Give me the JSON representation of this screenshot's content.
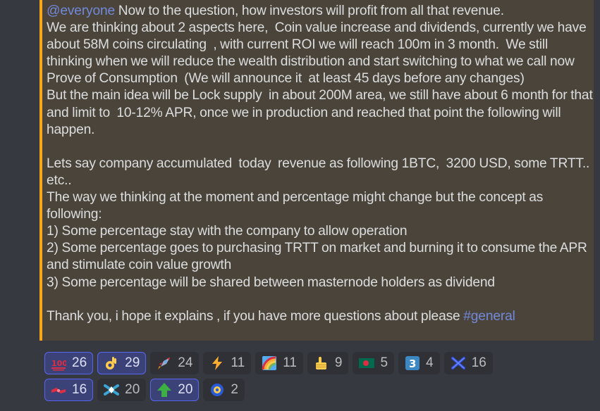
{
  "message": {
    "mention": "@everyone",
    "line1_rest": " Now to the question, how investors will profit from all that revenue.",
    "paragraph_main": "We are thinking about 2 aspects here,  Coin value increase and dividends, currently we have about 58M coins circulating  , with current ROI we will reach 100m in 3 month.  We still thinking when we will reduce the wealth distribution and start switching to what we call now Prove of Consumption  (We will announce it  at least 45 days before any changes)\nBut the main idea will be Lock supply  in about 200M area, we still have about 6 month for that and limit to  10-12% APR, once we in production and reached that point the following will happen.\n\nLets say company accumulated  today  revenue as following 1BTC,  3200 USD, some TRTT.. etc..\nThe way we thinking at the moment and percentage might change but the concept as following:\n1) Some percentage stay with the company to allow operation\n2) Some percentage goes to purchasing TRTT on market and burning it to consume the APR and stimulate coin value growth\n3) Some percentage will be shared between masternode holders as dividend\n\nThank you, i hope it explains , if you have more questions about please ",
    "channel": "#general"
  },
  "reactions": {
    "row1": [
      {
        "icon": "hundred-icon",
        "count": "26",
        "me": true
      },
      {
        "icon": "ok-hand-icon",
        "count": "29",
        "me": true
      },
      {
        "icon": "rocket-icon",
        "count": "24",
        "me": false
      },
      {
        "icon": "lightning-icon",
        "count": "11",
        "me": false
      },
      {
        "icon": "rainbow-icon",
        "count": "11",
        "me": false
      },
      {
        "icon": "thumbs-up-icon",
        "count": "9",
        "me": false
      },
      {
        "icon": "bangladesh-flag-icon",
        "count": "5",
        "me": false
      },
      {
        "icon": "keycap-three-icon",
        "count": "4",
        "me": false
      },
      {
        "icon": "cross-mark-icon",
        "count": "16",
        "me": false
      }
    ],
    "row2": [
      {
        "icon": "handshake-icon",
        "count": "16",
        "me": true
      },
      {
        "icon": "tortuga-logo-icon",
        "count": "20",
        "me": false
      },
      {
        "icon": "up-arrow-icon",
        "count": "20",
        "me": true
      },
      {
        "icon": "coin-icon",
        "count": "2",
        "me": false
      }
    ]
  },
  "colors": {
    "background": "#36393f",
    "highlight": "#4a443a",
    "highlight_bar": "#faa61a",
    "mention": "#7289da",
    "reaction_me_bg": "#3b4277",
    "reaction_me_border": "#5865f2"
  }
}
